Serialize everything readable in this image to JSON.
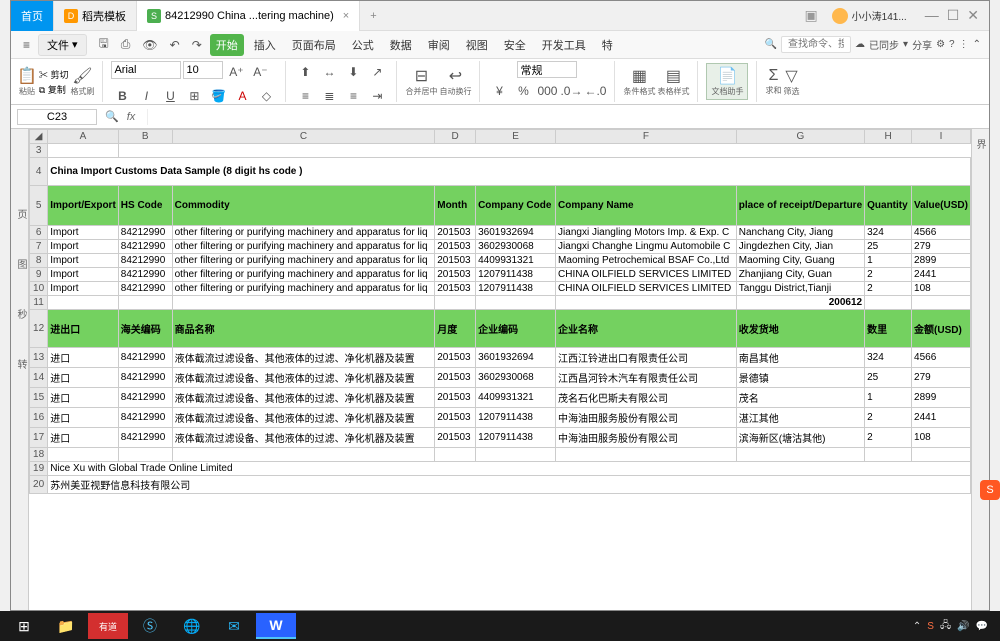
{
  "titlebar": {
    "home": "首页",
    "template": "稻壳模板",
    "doc_tab": "84212990 China ...tering machine)",
    "user": "小小涛141..."
  },
  "menubar": {
    "file": "文件",
    "items": [
      "开始",
      "插入",
      "页面布局",
      "公式",
      "数据",
      "审阅",
      "视图",
      "安全",
      "开发工具",
      "特"
    ],
    "find_label": "查找命令、搜索模板",
    "sync": "已同步",
    "share": "分享"
  },
  "toolbar": {
    "paste": "粘贴",
    "cut": "剪切",
    "copy": "复制",
    "format_painter": "格式刷",
    "font": "Arial",
    "font_size": "10",
    "merge": "合并居中",
    "wrap": "自动换行",
    "number_fmt": "常规",
    "cond_fmt": "条件格式",
    "table_style": "表格样式",
    "doc_assist": "文档助手",
    "sum": "求和",
    "filter": "筛选"
  },
  "formula_bar": {
    "name_box": "C23",
    "fx": "fx"
  },
  "columns": [
    "A",
    "B",
    "C",
    "D",
    "E",
    "F",
    "G",
    "H",
    "I"
  ],
  "title": "China Import Customs Data Sample (8 digit hs code )",
  "headers_en": [
    "Import/Export",
    "HS Code",
    "Commodity",
    "Month",
    "Company Code",
    "Company Name",
    "place of receipt/Departure",
    "Quantity",
    "Value(USD)"
  ],
  "rows_en": [
    [
      "Import",
      "84212990",
      "other filtering or purifying machinery and apparatus for liq",
      "201503",
      "3601932694",
      "Jiangxi Jiangling Motors Imp. & Exp. C",
      "Nanchang City, Jiang",
      "324",
      "4566"
    ],
    [
      "Import",
      "84212990",
      "other filtering or purifying machinery and apparatus for liq",
      "201503",
      "3602930068",
      "Jiangxi Changhe Lingmu Automobile C",
      "Jingdezhen City, Jian",
      "25",
      "279"
    ],
    [
      "Import",
      "84212990",
      "other filtering or purifying machinery and apparatus for liq",
      "201503",
      "4409931321",
      "Maoming Petrochemical BSAF Co.,Ltd",
      "Maoming City, Guang",
      "1",
      "2899"
    ],
    [
      "Import",
      "84212990",
      "other filtering or purifying machinery and apparatus for liq",
      "201503",
      "1207911438",
      "CHINA OILFIELD SERVICES LIMITED",
      "Zhanjiang City, Guan",
      "2",
      "2441"
    ],
    [
      "Import",
      "84212990",
      "other filtering or purifying machinery and apparatus for liq",
      "201503",
      "1207911438",
      "CHINA OILFIELD SERVICES LIMITED",
      "Tanggu District,Tianji",
      "2",
      "108"
    ]
  ],
  "row11_note": "200612",
  "headers_cn": [
    "进出口",
    "海关编码",
    "商品名称",
    "月度",
    "企业编码",
    "企业名称",
    "收发货地",
    "数里",
    "金额(USD)"
  ],
  "rows_cn": [
    [
      "进口",
      "84212990",
      "液体截流过滤设备、其他液体的过滤、净化机器及装置",
      "201503",
      "3601932694",
      "江西江铃进出口有限责任公司",
      "南昌其他",
      "324",
      "4566"
    ],
    [
      "进口",
      "84212990",
      "液体截流过滤设备、其他液体的过滤、净化机器及装置",
      "201503",
      "3602930068",
      "江西昌河铃木汽车有限责任公司",
      "景德镇",
      "25",
      "279"
    ],
    [
      "进口",
      "84212990",
      "液体截流过滤设备、其他液体的过滤、净化机器及装置",
      "201503",
      "4409931321",
      "茂名石化巴斯夫有限公司",
      "茂名",
      "1",
      "2899"
    ],
    [
      "进口",
      "84212990",
      "液体截流过滤设备、其他液体的过滤、净化机器及装置",
      "201503",
      "1207911438",
      "中海油田服务股份有限公司",
      "湛江其他",
      "2",
      "2441"
    ],
    [
      "进口",
      "84212990",
      "液体截流过滤设备、其他液体的过滤、净化机器及装置",
      "201503",
      "1207911438",
      "中海油田服务股份有限公司",
      "滨海新区(塘沽其他)",
      "2",
      "108"
    ]
  ],
  "footer_rows": [
    "Nice Xu with Global Trade Online Limited",
    "苏州美亚视野信息科技有限公司"
  ],
  "taskbar": {
    "items": [
      "⊞",
      "📁",
      "有道",
      "S",
      "🌐",
      "✉",
      "W"
    ]
  }
}
